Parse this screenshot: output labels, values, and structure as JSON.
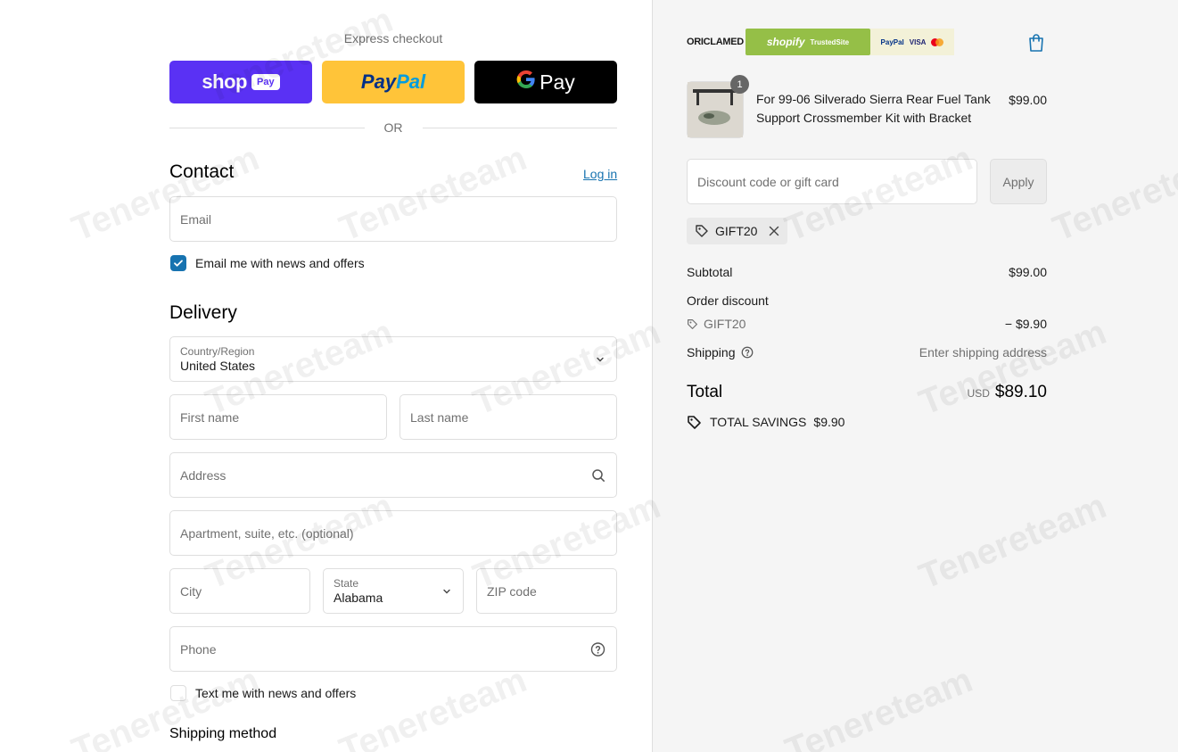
{
  "express": {
    "label": "Express checkout",
    "shop_word": "shop",
    "shop_badge": "Pay",
    "paypal_pay": "Pay",
    "paypal_pal": "Pal",
    "gpay_g": "G",
    "gpay_word": "Pay",
    "or_text": "OR"
  },
  "contact": {
    "heading": "Contact",
    "login_link": "Log in",
    "email_placeholder": "Email",
    "news_checkbox_label": "Email me with news and offers",
    "news_checked": true
  },
  "delivery": {
    "heading": "Delivery",
    "country_label": "Country/Region",
    "country_value": "United States",
    "first_name_placeholder": "First name",
    "last_name_placeholder": "Last name",
    "address_placeholder": "Address",
    "apartment_placeholder": "Apartment, suite, etc. (optional)",
    "city_placeholder": "City",
    "state_label": "State",
    "state_value": "Alabama",
    "zip_placeholder": "ZIP code",
    "phone_placeholder": "Phone",
    "sms_checkbox_label": "Text me with news and offers",
    "sms_checked": false
  },
  "shipping_method": {
    "heading": "Shipping method"
  },
  "summary": {
    "trust": {
      "brand": "ORICLAMED",
      "shopify": "shopify",
      "trusted": "TrustedSite",
      "paypal": "PayPal",
      "visa": "VISA"
    },
    "product": {
      "quantity": "1",
      "title": "For 99-06 Silverado Sierra Rear Fuel Tank Support Crossmember Kit with Bracket",
      "price": "$99.00"
    },
    "discount_placeholder": "Discount code or gift card",
    "apply_label": "Apply",
    "applied_code": "GIFT20",
    "subtotal_label": "Subtotal",
    "subtotal_value": "$99.00",
    "order_discount_label": "Order discount",
    "discount_code": "GIFT20",
    "discount_value": "− $9.90",
    "shipping_label": "Shipping",
    "shipping_value": "Enter shipping address",
    "total_label": "Total",
    "total_currency": "USD",
    "total_value": "$89.10",
    "savings_label": "TOTAL SAVINGS",
    "savings_value": "$9.90"
  },
  "watermark": {
    "text": "Tenereteam"
  },
  "colors": {
    "shop_pay": "#5a31f4",
    "paypal": "#ffc439",
    "gpay": "#000000",
    "link": "#1773b0",
    "summary_bg": "#f5f5f5"
  }
}
